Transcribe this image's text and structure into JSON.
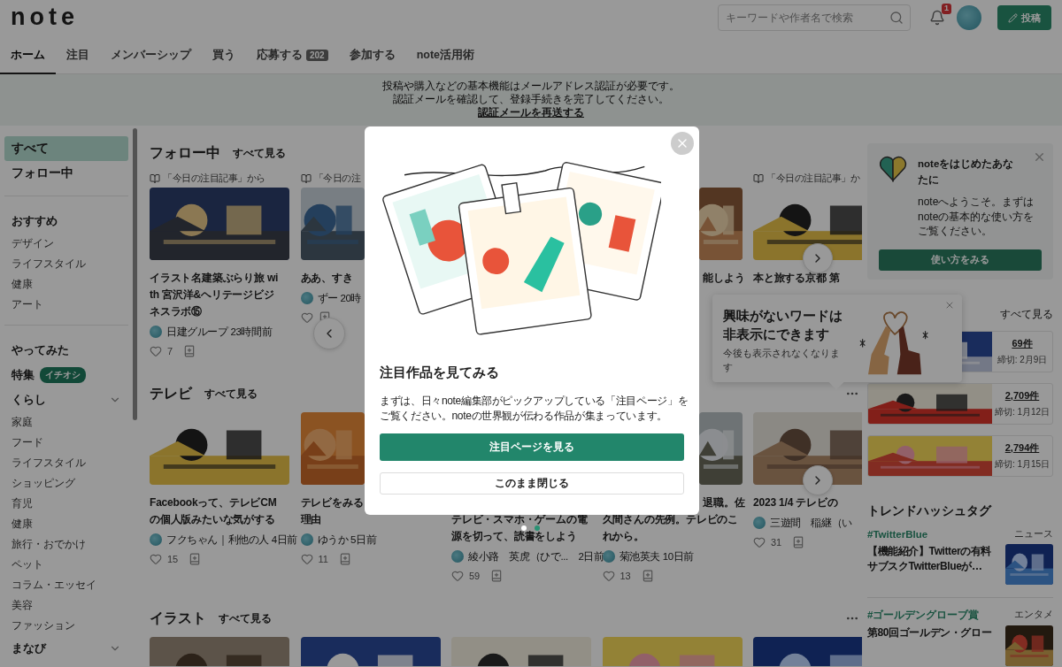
{
  "header": {
    "logo": "note",
    "search": {
      "placeholder": "キーワードや作者名で検索"
    },
    "notification_count": "1",
    "post_button": "投稿"
  },
  "tabs": [
    {
      "label": "ホーム",
      "selected": true
    },
    {
      "label": "注目",
      "selected": false
    },
    {
      "label": "メンバーシップ",
      "selected": false
    },
    {
      "label": "買う",
      "selected": false
    },
    {
      "label": "応募する",
      "badge": "202",
      "selected": false
    },
    {
      "label": "参加する",
      "selected": false
    },
    {
      "label": "note活用術",
      "selected": false
    }
  ],
  "notice": {
    "lines": [
      "投稿や購入などの基本機能はメールアドレス認証が必要です。",
      "認証メールを確認して、登録手続きを完了してください。"
    ],
    "link": "認証メールを再送する"
  },
  "sidebar": {
    "items": [
      {
        "kind": "top",
        "label": "すべて",
        "selected": true
      },
      {
        "kind": "top",
        "label": "フォロー中",
        "selected": false
      },
      {
        "kind": "divider"
      },
      {
        "kind": "heading",
        "label": "おすすめ",
        "selected": false
      },
      {
        "kind": "item",
        "label": "デザイン",
        "selected": false
      },
      {
        "kind": "item",
        "label": "ライフスタイル",
        "selected": false
      },
      {
        "kind": "item",
        "label": "健康",
        "selected": false
      },
      {
        "kind": "item",
        "label": "アート",
        "selected": false
      },
      {
        "kind": "divider"
      },
      {
        "kind": "heading",
        "label": "やってみた",
        "selected": false
      },
      {
        "kind": "heading",
        "label": "特集",
        "badge": "イチオシ",
        "selected": false
      },
      {
        "kind": "group",
        "label": "くらし",
        "selected": false
      },
      {
        "kind": "item",
        "label": "家庭",
        "selected": false
      },
      {
        "kind": "item",
        "label": "フード",
        "selected": false
      },
      {
        "kind": "item",
        "label": "ライフスタイル",
        "selected": false
      },
      {
        "kind": "item",
        "label": "ショッピング",
        "selected": false
      },
      {
        "kind": "item",
        "label": "育児",
        "selected": false
      },
      {
        "kind": "item",
        "label": "健康",
        "selected": false
      },
      {
        "kind": "item",
        "label": "旅行・おでかけ",
        "selected": false
      },
      {
        "kind": "item",
        "label": "ペット",
        "selected": false
      },
      {
        "kind": "item",
        "label": "コラム・エッセイ",
        "selected": false
      },
      {
        "kind": "item",
        "label": "美容",
        "selected": false
      },
      {
        "kind": "item",
        "label": "ファッション",
        "selected": false
      },
      {
        "kind": "group",
        "label": "まなび",
        "selected": false
      }
    ]
  },
  "feed": {
    "sections": [
      {
        "title": "フォロー中",
        "more": "すべて見る",
        "prev_arrow": true,
        "next_arrow": true,
        "cards": [
          {
            "kind": "full",
            "label": "「今日の注目記事」から",
            "title_lines": [
              "イラスト名建築ぶらり旅 wi",
              "th 宮沢洋&ヘリテージビジ",
              "ネスラボ⑮"
            ],
            "author": "日建グループ 23時間前",
            "likes": "7"
          },
          {
            "kind": "left-edge",
            "label": "「今日の注",
            "title_lines": [
              "ああ、すき"
            ],
            "author": "ずー 20時"
          },
          {
            "kind": "covered"
          },
          {
            "kind": "right-edge",
            "title_lines": [
              "能しよう"
            ]
          },
          {
            "kind": "full",
            "label": "「今日の注目記事」か",
            "title_lines": [
              "本と旅する京都 第"
            ]
          }
        ]
      },
      {
        "title": "テレビ",
        "more": "すべて見る",
        "menu": true,
        "next_arrow": true,
        "cards": [
          {
            "kind": "full",
            "title_lines": [
              "Facebookって、テレビCM",
              "の個人版みたいな気がする"
            ],
            "author": "フクちゃん｜利他の人 4日前",
            "likes": "15"
          },
          {
            "kind": "left-edge",
            "title_lines": [
              "テレビをみる",
              "理由"
            ],
            "author": "ゆうか 5日前",
            "likes": "11"
          },
          {
            "kind": "below-modal",
            "title_lines": [
              "テレビ・スマホ・ゲームの電",
              "源を切って、読書をしよう"
            ],
            "author": "綾小路　英虎（ひで...　2日前",
            "likes": "59"
          },
          {
            "kind": "right-edge",
            "title_lines": [
              "退職。佐",
              "久間さんの先例。テレビのこ",
              "れから。"
            ],
            "author": "菊池英夫 10日前",
            "likes": "13"
          },
          {
            "kind": "full",
            "title_lines": [
              "2023 1/4 テレビの"
            ],
            "author": "三遊間　稲継（い",
            "likes": "31"
          }
        ]
      },
      {
        "title": "イラスト",
        "more": "すべて見る",
        "menu": true,
        "cards": [
          {
            "kind": "image-only"
          },
          {
            "kind": "image-only"
          },
          {
            "kind": "image-only"
          },
          {
            "kind": "image-only"
          },
          {
            "kind": "image-only"
          }
        ]
      }
    ]
  },
  "welcome": {
    "title": "noteをはじめたあなたに",
    "body_lines": [
      "noteへようこそ。まずは",
      "noteの基本的な使い方を",
      "ご覧ください。"
    ],
    "button": "使い方をみる"
  },
  "contests": {
    "more": "すべて見る",
    "items": [
      {
        "count": "69件",
        "deadline": "締切: 2月9日"
      },
      {
        "count": "2,709件",
        "deadline": "締切: 1月12日"
      },
      {
        "count": "2,794件",
        "deadline": "締切: 1月15日"
      }
    ]
  },
  "trends": {
    "title": "トレンドハッシュタグ",
    "items": [
      {
        "tag": "#TwitterBlue",
        "category": "ニュース",
        "title_lines": [
          "【機能紹介】Twitterの有料",
          "サブスクTwitterBlueが…"
        ]
      },
      {
        "tag": "#ゴールデングローブ賞",
        "category": "エンタメ",
        "title_lines": [
          "第80回ゴールデン・グロー"
        ]
      }
    ]
  },
  "popover": {
    "headline_lines": [
      "興味がないワードは",
      "非表示にできます"
    ],
    "body": "今後も表示されなくなります"
  },
  "modal": {
    "title": "注目作品を見てみる",
    "body_lines": [
      "まずは、日々note編集部がピックアップしている「注目ページ」を",
      "ご覧ください。noteの世界観が伝わる作品が集まっています。"
    ],
    "primary": "注目ページを見る",
    "secondary": "このまま閉じる",
    "pages": [
      {
        "selected": false
      },
      {
        "selected": true
      }
    ]
  }
}
